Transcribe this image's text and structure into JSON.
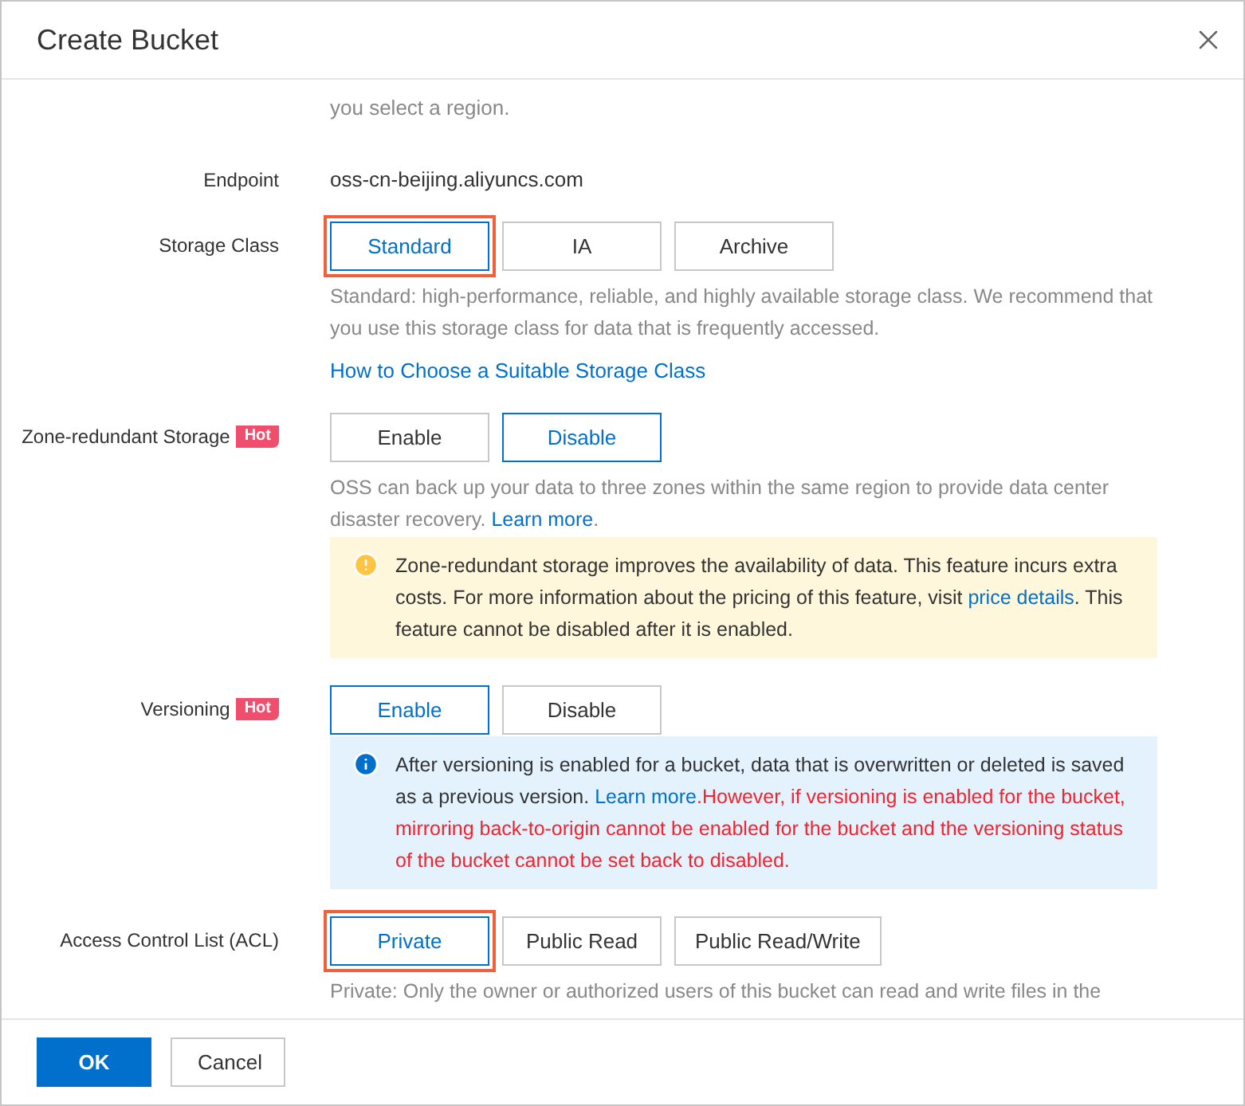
{
  "dialog": {
    "title": "Create Bucket"
  },
  "intro": "you select a region.",
  "fields": [
    {
      "kind": "text",
      "label": "Endpoint",
      "value": "oss-cn-beijing.aliyuncs.com"
    },
    {
      "kind": "options",
      "label": "Storage Class",
      "options": [
        {
          "label": "Standard",
          "selected": true,
          "highlighted": true
        },
        {
          "label": "IA",
          "selected": false,
          "highlighted": false
        },
        {
          "label": "Archive",
          "selected": false,
          "highlighted": false
        }
      ],
      "description": [
        {
          "kind": "text",
          "text": "Standard: high-performance, reliable, and highly available storage class. We recommend that you use this storage class for data that is frequently accessed."
        }
      ],
      "link": "How to Choose a Suitable Storage Class"
    },
    {
      "kind": "options",
      "label": "Zone-redundant Storage",
      "badge": "Hot",
      "options": [
        {
          "label": "Enable",
          "selected": false,
          "highlighted": false
        },
        {
          "label": "Disable",
          "selected": true,
          "highlighted": false
        }
      ],
      "description": [
        {
          "kind": "text",
          "text": "OSS can back up your data to three zones within the same region to provide data center disaster recovery. "
        },
        {
          "kind": "link",
          "text": "Learn more"
        },
        {
          "kind": "text",
          "text": "."
        }
      ],
      "alert": {
        "kind": "warning",
        "parts": [
          {
            "kind": "text",
            "text": "Zone-redundant storage improves the availability of data. This feature incurs extra costs. For more information about the pricing of this feature, visit "
          },
          {
            "kind": "link",
            "text": "price details"
          },
          {
            "kind": "text",
            "text": ". This feature cannot be disabled after it is enabled."
          }
        ]
      }
    },
    {
      "kind": "options",
      "label": "Versioning",
      "badge": "Hot",
      "options": [
        {
          "label": "Enable",
          "selected": true,
          "highlighted": false
        },
        {
          "label": "Disable",
          "selected": false,
          "highlighted": false
        }
      ],
      "alert": {
        "kind": "info",
        "parts": [
          {
            "kind": "text",
            "text": "After versioning is enabled for a bucket, data that is overwritten or deleted is saved as a previous version. "
          },
          {
            "kind": "link",
            "text": "Learn more"
          },
          {
            "kind": "warning",
            "text": ".However, if versioning is enabled for the bucket, mirroring back-to-origin cannot be enabled for the bucket and the versioning status of the bucket cannot be set back to disabled."
          }
        ]
      }
    },
    {
      "kind": "options",
      "label": "Access Control List (ACL)",
      "options": [
        {
          "label": "Private",
          "selected": true,
          "highlighted": true
        },
        {
          "label": "Public Read",
          "selected": false,
          "highlighted": false
        },
        {
          "label": "Public Read/Write",
          "selected": false,
          "highlighted": false
        }
      ],
      "description": [
        {
          "kind": "text",
          "text": "Private: Only the owner or authorized users of this bucket can read and write files in the"
        }
      ]
    }
  ],
  "footer": {
    "buttons": [
      {
        "label": "OK",
        "kind": "primary"
      },
      {
        "label": "Cancel",
        "kind": "secondary"
      }
    ]
  }
}
